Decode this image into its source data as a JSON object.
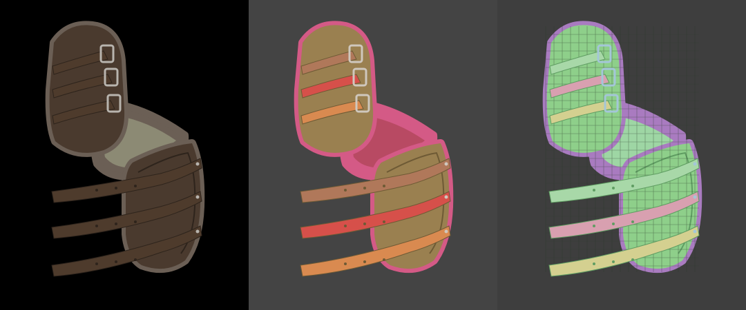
{
  "panels": [
    {
      "id": "render",
      "background": "#000000",
      "shell": "#4a3a2e",
      "shell_dark": "#2e241c",
      "fur": "#6b5f55",
      "liner": "#8c8a74",
      "strap_colors": [
        "#4e3b2c",
        "#4e3b2c",
        "#4e3b2c"
      ],
      "buckle": "#b8b4ae",
      "wire": false
    },
    {
      "id": "material-ids",
      "background": "#444444",
      "shell": "#9a8050",
      "shell_dark": "#6e5a35",
      "fur": "#d45a86",
      "liner": "#b84a63",
      "strap_colors": [
        "#b0785a",
        "#d6504a",
        "#d98a50"
      ],
      "buckle": "#cfc7bd",
      "wire": false
    },
    {
      "id": "wireframe-uv",
      "background": "#3e3e3e",
      "shell": "#8ecf8a",
      "shell_dark": "#5f9d62",
      "fur": "#a97bc0",
      "liner": "#9ed6a4",
      "strap_colors": [
        "#a8d8a8",
        "#d8a0b0",
        "#d4d090"
      ],
      "buckle": "#a4c6d8",
      "wire": true
    }
  ]
}
